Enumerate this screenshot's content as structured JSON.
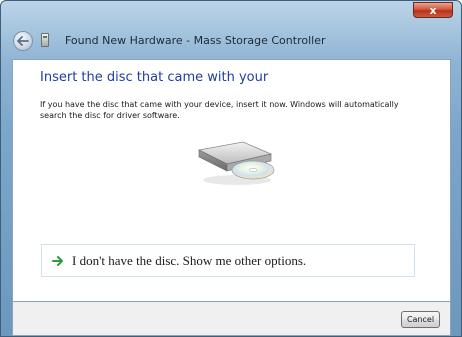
{
  "window": {
    "title": "Found New Hardware - Mass Storage Controller",
    "close_symbol": "x"
  },
  "main": {
    "heading": "Insert the disc that came with your",
    "description": "If you have the disc that came with your device, insert it now.  Windows will automatically search the disc for driver software."
  },
  "option": {
    "label": "I don't have the disc.  Show me other options."
  },
  "footer": {
    "cancel_label": "Cancel"
  },
  "icons": {
    "back": "back-arrow-icon",
    "hardware": "hardware-device-icon",
    "disc": "disc-drive-icon",
    "option_arrow": "green-arrow-icon",
    "close": "close-icon"
  },
  "colors": {
    "heading": "#1e3ea0",
    "option_arrow": "#2e9a3a",
    "close_button": "#c8442a"
  }
}
